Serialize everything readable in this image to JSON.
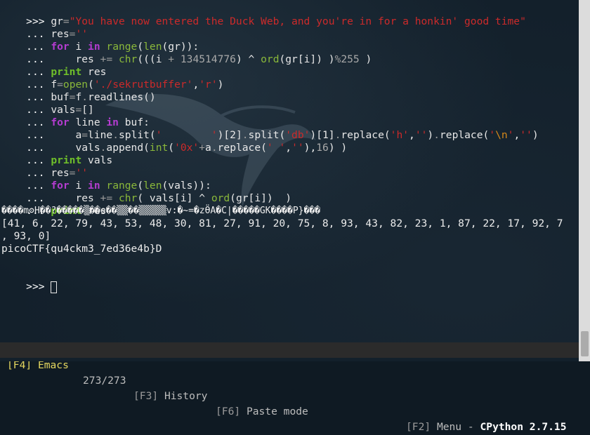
{
  "prompt": {
    "primary": ">>> ",
    "continuation": "... "
  },
  "code": {
    "l1": {
      "gr": "gr",
      "eq": "=",
      "string": "\"You have now entered the Duck Web, and you're in for a honkin' good time\""
    },
    "l2": {
      "res": "res",
      "eq": "=",
      "string": "''"
    },
    "l3": {
      "for": "for",
      "i": " i ",
      "in": "in",
      "sp": " ",
      "range": "range",
      "p1": "(",
      "len": "len",
      "rest": "(gr)):"
    },
    "l4": {
      "indent": "    res ",
      "op": "+=",
      "sp": " ",
      "chr": "chr",
      "a": "(((i ",
      "plus": "+",
      "sp2": " ",
      "num": "134514776",
      "b": ") ",
      "xor": "^",
      "sp3": " ",
      "ord": "ord",
      "c": "(gr[i]) )",
      "mod": "%",
      "num2": "255",
      "d": " )"
    },
    "l5": {
      "print": "print",
      "rest": " res"
    },
    "l6": {
      "f": "f",
      "eq": "=",
      "open": "open",
      "p": "(",
      "s1": "'./sekrutbuffer'",
      "comma": ",",
      "s2": "'r'",
      "pe": ")"
    },
    "l7": {
      "a": "buf",
      "eq": "=",
      "b": "f",
      "dot": ".",
      "c": "readlines()"
    },
    "l8": {
      "a": "vals",
      "eq": "=",
      "b": "[]"
    },
    "l9": {
      "for": "for",
      "a": " line ",
      "in": "in",
      "b": " buf:"
    },
    "l10": {
      "indent": "    a",
      "eq": "=",
      "b": "line",
      "dot": ".",
      "c": "split(",
      "s1": "'        '",
      "d": ")[2]",
      "dot2": ".",
      "e": "split(",
      "s2": "'db'",
      "f": ")[1]",
      "dot3": ".",
      "g": "replace(",
      "s3": "'h'",
      "comma": ",",
      "s4": "''",
      "h": ")",
      "dot4": ".",
      "i": "replace(",
      "s5a": "'",
      "esc": "\\n",
      "s5b": "'",
      "comma2": ",",
      "s6": "''",
      "j": ")"
    },
    "l11": {
      "indent": "    vals",
      "dot": ".",
      "a": "append(",
      "int": "int",
      "p": "(",
      "s1": "'0x'",
      "plus": "+",
      "b": "a",
      "dot2": ".",
      "c": "replace(",
      "s2": "' '",
      "comma": ",",
      "s3": "''",
      "d": "),",
      "num": "16",
      "e": ") )"
    },
    "l12": {
      "print": "print",
      "rest": " vals"
    },
    "l13": {
      "res": "res",
      "eq": "=",
      "string": "''"
    },
    "l14": {
      "for": "for",
      "i": " i ",
      "in": "in",
      "sp": " ",
      "range": "range",
      "p1": "(",
      "len": "len",
      "rest": "(vals)):"
    },
    "l15": {
      "indent": "    res ",
      "op": "+=",
      "sp": " ",
      "chr": "chr",
      "a": "( vals[i] ",
      "xor": "^",
      "sp2": " ",
      "ord": "ord",
      "b": "(gr[i])  )"
    },
    "l16": {
      "print": "print",
      "rest": " res"
    }
  },
  "output": {
    "garbled": "����mʘH��?�����▒��e��▒▒��▒▒▒▒▒v:�~=�zӪA�C|�����GK����P}���",
    "vals_line1": "[41, 6, 22, 79, 43, 53, 48, 30, 81, 27, 91, 20, 75, 8, 93, 43, 82, 23, 1, 87, 22, 17, 92, 7",
    "vals_line2": ", 93, 0]",
    "flag": "picoCTF{qu4ckm3_7ed36e4b}D"
  },
  "statusbar": {
    "f4_key": "[F4]",
    "editor": "Emacs",
    "position": "273/273",
    "f3_key": "[F3]",
    "history": "History",
    "f6_key": "[F6]",
    "paste": "Paste mode",
    "f2_key": "[F2]",
    "menu": "Menu",
    "dash": "-",
    "interpreter": "CPython 2.7.15"
  },
  "colors": {
    "background": "#13202b",
    "string": "#cc2a2a",
    "keyword": "#b43cd0",
    "builtin": "#8ab83a",
    "statusbar_bg": "#2b2b2b",
    "statusbar_key": "#e6d860"
  }
}
